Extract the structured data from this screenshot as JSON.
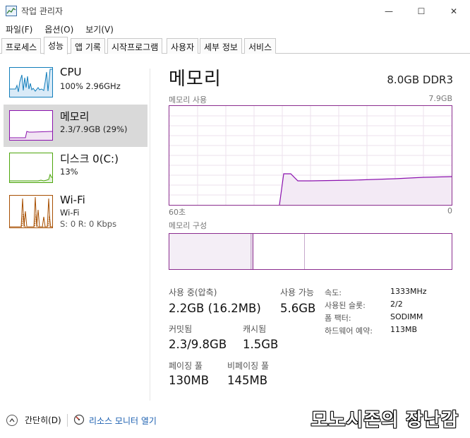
{
  "window": {
    "title": "작업 관리자",
    "minimize_glyph": "—",
    "maximize_glyph": "☐",
    "close_glyph": "✕"
  },
  "menu": [
    "파일(F)",
    "옵션(O)",
    "보기(V)"
  ],
  "tabs": [
    "프로세스",
    "성능",
    "앱 기록",
    "시작프로그램",
    "사용자",
    "세부 정보",
    "서비스"
  ],
  "active_tab": "성능",
  "sidebar": {
    "items": [
      {
        "name": "CPU",
        "sub1": "100% 2.96GHz",
        "sub2": "",
        "color": "#117dbb",
        "icon": "cpu-graph-icon"
      },
      {
        "name": "메모리",
        "sub1": "2.3/7.9GB (29%)",
        "sub2": "",
        "color": "#8b12ae",
        "icon": "memory-graph-icon"
      },
      {
        "name": "디스크 0(C:)",
        "sub1": "13%",
        "sub2": "",
        "color": "#4da60c",
        "icon": "disk-graph-icon"
      },
      {
        "name": "Wi-Fi",
        "sub1": "Wi-Fi",
        "sub2": "S: 0 R: 0 Kbps",
        "color": "#a74f01",
        "icon": "wifi-graph-icon"
      }
    ],
    "selected": "메모리"
  },
  "main": {
    "title": "메모리",
    "spec": "8.0GB DDR3",
    "usage_label": "메모리 사용",
    "usage_max": "7.9GB",
    "time_left": "60초",
    "time_right": "0",
    "composition_label": "메모리 구성",
    "accent_color": "#8b2d8f",
    "stats": {
      "in_use_label": "사용 중(압축)",
      "in_use_value": "2.2GB (16.2MB)",
      "available_label": "사용 가능",
      "available_value": "5.6GB",
      "committed_label": "커밋됨",
      "committed_value": "2.3/9.8GB",
      "cached_label": "캐시됨",
      "cached_value": "1.5GB",
      "paged_label": "페이징 풀",
      "paged_value": "130MB",
      "nonpaged_label": "비페이징 풀",
      "nonpaged_value": "145MB"
    },
    "info": {
      "speed_label": "속도:",
      "speed_value": "1333MHz",
      "slots_label": "사용된 슬롯:",
      "slots_value": "2/2",
      "form_label": "폼 팩터:",
      "form_value": "SODIMM",
      "reserved_label": "하드웨어 예약:",
      "reserved_value": "113MB"
    }
  },
  "bottom": {
    "collapse_label": "간단히(D)",
    "monitor_label": "리소스 모니터 열기"
  },
  "watermark": "모노시존의 장난감"
}
